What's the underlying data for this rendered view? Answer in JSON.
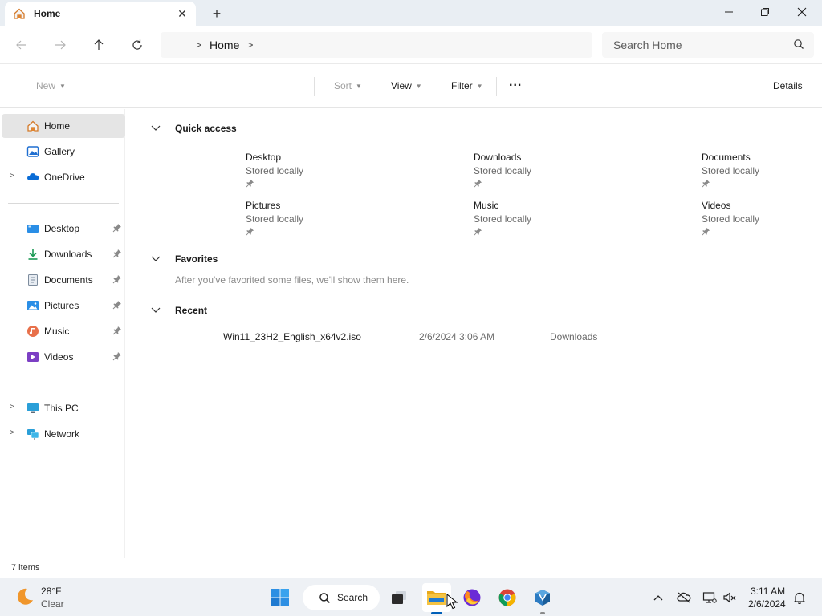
{
  "window": {
    "tab_title": "Home",
    "tab_icon": "home-icon",
    "controls": [
      "minimize-icon",
      "maximize-icon",
      "close-icon"
    ]
  },
  "address": {
    "breadcrumb": [
      "Home"
    ],
    "search_placeholder": "Search Home"
  },
  "commandbar": {
    "new_label": "New",
    "sort_label": "Sort",
    "view_label": "View",
    "filter_label": "Filter",
    "more_label": "...",
    "details_label": "Details"
  },
  "sidebar": {
    "top": [
      {
        "label": "Home",
        "icon": "home-icon"
      },
      {
        "label": "Gallery",
        "icon": "gallery-icon"
      },
      {
        "label": "OneDrive",
        "icon": "cloud-icon"
      }
    ],
    "pinned": [
      {
        "label": "Desktop",
        "icon": "desktop-icon"
      },
      {
        "label": "Downloads",
        "icon": "download-icon"
      },
      {
        "label": "Documents",
        "icon": "document-icon"
      },
      {
        "label": "Pictures",
        "icon": "picture-icon"
      },
      {
        "label": "Music",
        "icon": "music-icon"
      },
      {
        "label": "Videos",
        "icon": "video-icon"
      }
    ],
    "bottom": [
      {
        "label": "This PC",
        "icon": "monitor-icon"
      },
      {
        "label": "Network",
        "icon": "network-icon"
      }
    ]
  },
  "main": {
    "quick_access_title": "Quick access",
    "quick_access": [
      {
        "name": "Desktop",
        "sub": "Stored locally"
      },
      {
        "name": "Downloads",
        "sub": "Stored locally"
      },
      {
        "name": "Documents",
        "sub": "Stored locally"
      },
      {
        "name": "Pictures",
        "sub": "Stored locally"
      },
      {
        "name": "Music",
        "sub": "Stored locally"
      },
      {
        "name": "Videos",
        "sub": "Stored locally"
      }
    ],
    "favorites_title": "Favorites",
    "favorites_hint": "After you've favorited some files, we'll show them here.",
    "recent_title": "Recent",
    "recent": [
      {
        "name": "Win11_23H2_English_x64v2.iso",
        "date": "2/6/2024 3:06 AM",
        "location": "Downloads"
      }
    ]
  },
  "status": {
    "item_count": "7 items"
  },
  "taskbar": {
    "weather_temp": "28°F",
    "weather_cond": "Clear",
    "search_label": "Search",
    "time": "3:11 AM",
    "date": "2/6/2024"
  },
  "colors": {
    "accent": "#005fb8",
    "folder": "#f5c342",
    "selected": "#e5e5e5"
  }
}
